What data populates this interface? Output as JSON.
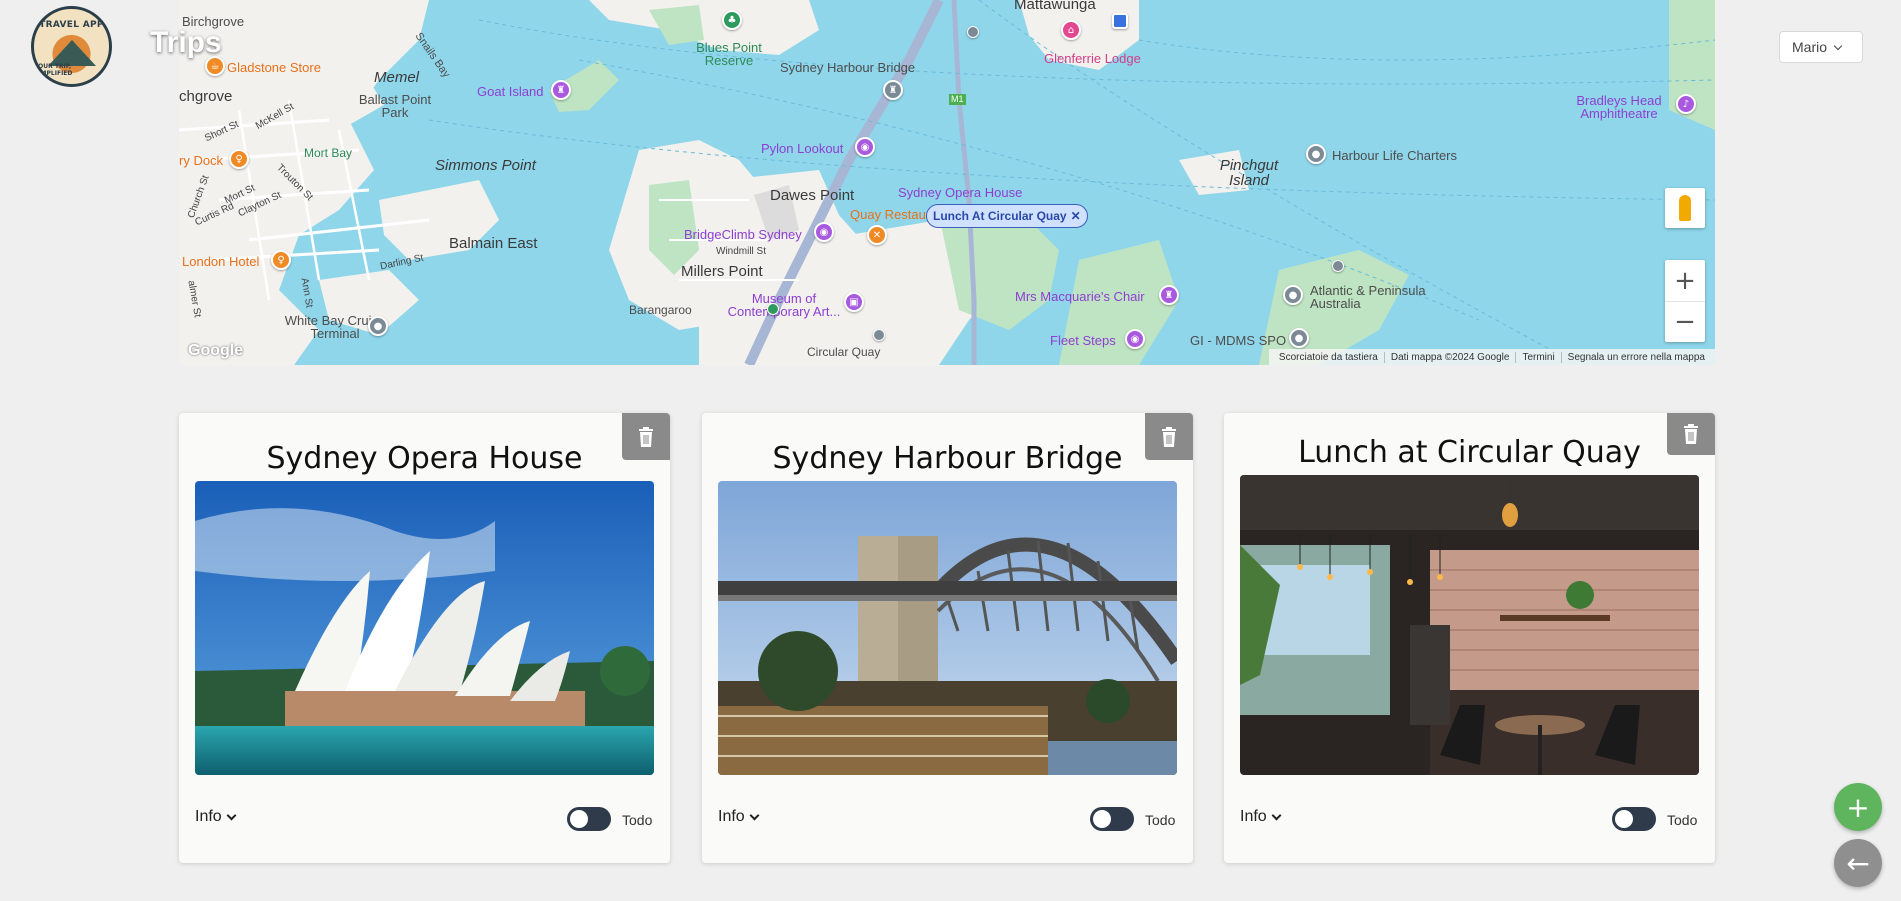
{
  "header": {
    "logo_top": "TRAVEL APP",
    "logo_bottom": "YOUR TRIP, SIMPLIFIED",
    "title": "Trips",
    "user": "Mario"
  },
  "map": {
    "places": {
      "mattawunga": "Mattawunga",
      "memel": "Memel",
      "birchgrove": "Birchgrove",
      "birchgrove_area": "chgrove",
      "ballast_point": "Ballast Point Park",
      "simmons_point": "Simmons Point",
      "balmain_east": "Balmain East",
      "dawes_point": "Dawes Point",
      "millers_point": "Millers Point",
      "barangaroo": "Barangaroo",
      "pinchgut": "Pinchgut Island",
      "mort_bay": "Mort Bay",
      "snails_bay": "Snails Bay",
      "white_bay": "White Bay Cruise Terminal",
      "circular_quay": "Circular Quay"
    },
    "pois": {
      "gladstone": "Gladstone Store",
      "goat_island": "Goat Island",
      "blues_point": "Blues Point Reserve",
      "harbour_bridge": "Sydney Harbour Bridge",
      "glenferrie": "Glenferrie Lodge",
      "bradleys_head": "Bradleys Head Amphitheatre",
      "harbour_life": "Harbour Life Charters",
      "pylon_lookout": "Pylon Lookout",
      "opera_house": "Sydney Opera House",
      "quay_restaurant": "Quay Restau",
      "bridgeclimb": "BridgeClimb Sydney",
      "museum": "Museum of Contemporary Art...",
      "mrs_macquarie": "Mrs Macquarie's Chair",
      "fleet_steps": "Fleet Steps",
      "atlantic": "Atlantic & Peninsula Australia",
      "gi_mdms": "GI - MDMS SPO",
      "dry_dock": "ry Dock",
      "london_hotel": "London Hotel"
    },
    "streets": {
      "short_st": "Short St",
      "mckell_st": "McKell St",
      "church_st": "Church St",
      "mort_st": "Mort St",
      "curtis_rd": "Curtis Rd",
      "clayton_st": "Clayton St",
      "trouton_st": "Trouton St",
      "darling_st": "Darling St",
      "ann_st": "Ann St",
      "palmer_st": "almer St",
      "windmill_st": "Windmill St",
      "m1": "M1"
    },
    "selected_chip": "Lunch At Circular Quay",
    "google": "Google",
    "attribution": [
      "Scorciatoie da tastiera",
      "Dati mappa ©2024 Google",
      "Termini",
      "Segnala un errore nella mappa"
    ],
    "zoom_in": "+",
    "zoom_out": "−"
  },
  "cards": [
    {
      "title": "Sydney Opera House",
      "info": "Info",
      "todo": "Todo",
      "todo_enabled": false
    },
    {
      "title": "Sydney Harbour Bridge",
      "info": "Info",
      "todo": "Todo",
      "todo_enabled": false
    },
    {
      "title": "Lunch at Circular Quay",
      "info": "Info",
      "todo": "Todo",
      "todo_enabled": false
    }
  ],
  "fabs": {
    "add": "+",
    "back": "←"
  },
  "colors": {
    "fab_add": "#5eb55e",
    "fab_back": "#8f8f8f",
    "delete_bg": "#8a8a8a",
    "water": "#8fd6eb",
    "chip_border": "#3b5fbd"
  }
}
